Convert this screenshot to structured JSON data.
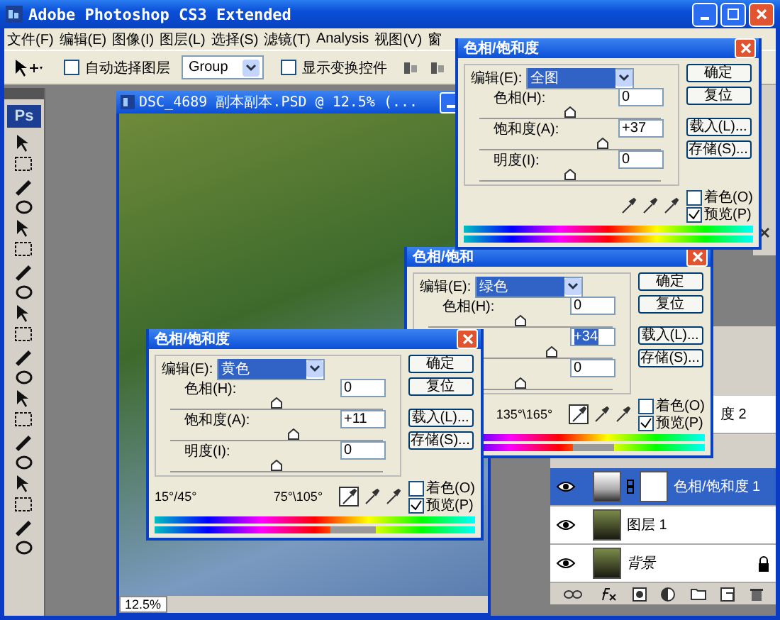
{
  "window": {
    "title": "Adobe Photoshop CS3 Extended"
  },
  "menu": [
    "文件(F)",
    "编辑(E)",
    "图像(I)",
    "图层(L)",
    "选择(S)",
    "滤镜(T)",
    "Analysis",
    "视图(V)",
    "窗"
  ],
  "options_bar": {
    "auto_select": {
      "label": "自动选择图层",
      "checked": false
    },
    "target": "Group",
    "show_transform": {
      "label": "显示变换控件",
      "checked": false
    }
  },
  "toolbox": {
    "logo": "Ps"
  },
  "document": {
    "title": "DSC_4689 副本副本.PSD @ 12.5% (...",
    "zoom": "12.5%"
  },
  "layers": [
    {
      "name": "度 2",
      "selected": false,
      "kind": "partial"
    },
    {
      "name": "色相/饱和度 1",
      "selected": true,
      "kind": "adjustment"
    },
    {
      "name": "图层 1",
      "selected": false,
      "kind": "pixel"
    },
    {
      "name": "背景",
      "selected": false,
      "kind": "background"
    }
  ],
  "dialogs": [
    {
      "title": "色相/饱和度",
      "edit_label": "编辑(E):",
      "edit_value": "全图",
      "sliders": [
        {
          "label": "色相(H):",
          "value": "0",
          "level": 0.5,
          "focused": false
        },
        {
          "label": "饱和度(A):",
          "value": "+37",
          "level": 0.68,
          "focused": false
        },
        {
          "label": "明度(I):",
          "value": "0",
          "level": 0.5,
          "focused": false
        }
      ],
      "buttons": [
        "确定",
        "复位",
        "载入(L)...",
        "存储(S)..."
      ],
      "colorize": {
        "label": "着色(O)",
        "checked": false
      },
      "preview": {
        "label": "预览(P)",
        "checked": true
      }
    },
    {
      "title": "色相/饱和",
      "edit_label": "编辑(E):",
      "edit_value": "绿色",
      "sliders": [
        {
          "label": "色相(H):",
          "value": "0",
          "level": 0.5,
          "focused": false
        },
        {
          "value": "+34",
          "level": 0.67,
          "focused": true
        },
        {
          "value": "0",
          "level": 0.5,
          "focused": false
        }
      ],
      "buttons": [
        "确定",
        "复位",
        "载入(L)...",
        "存储(S)..."
      ],
      "colorize": {
        "label": "着色(O)",
        "checked": false
      },
      "preview": {
        "label": "预览(P)",
        "checked": true
      },
      "ranges": [
        "135°\\165°"
      ]
    },
    {
      "title": "色相/饱和度",
      "edit_label": "编辑(E):",
      "edit_value": "黄色",
      "sliders": [
        {
          "label": "色相(H):",
          "value": "0",
          "level": 0.5,
          "focused": false
        },
        {
          "label": "饱和度(A):",
          "value": "+11",
          "level": 0.58,
          "focused": false
        },
        {
          "label": "明度(I):",
          "value": "0",
          "level": 0.5,
          "focused": false
        }
      ],
      "buttons": [
        "确定",
        "复位",
        "载入(L)...",
        "存储(S)..."
      ],
      "colorize": {
        "label": "着色(O)",
        "checked": false
      },
      "preview": {
        "label": "预览(P)",
        "checked": true
      },
      "ranges": [
        "15°/45°",
        "75°\\105°"
      ]
    }
  ]
}
